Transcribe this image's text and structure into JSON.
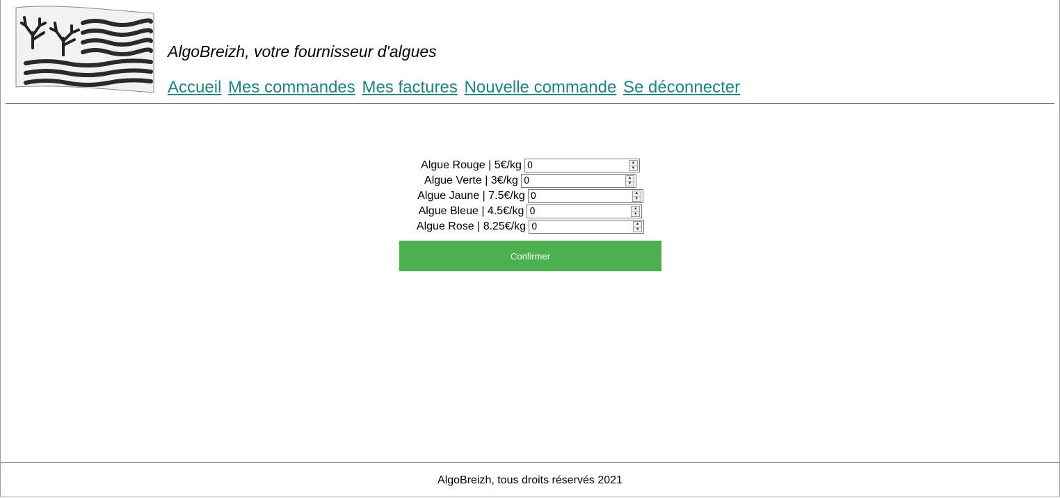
{
  "header": {
    "site_title": "AlgoBreizh, votre fournisseur d'algues",
    "nav": [
      {
        "label": "Accueil"
      },
      {
        "label": "Mes commandes"
      },
      {
        "label": "Mes factures"
      },
      {
        "label": "Nouvelle commande"
      },
      {
        "label": "Se déconnecter"
      }
    ],
    "logo_icon": "seaweed-flag-logo-icon"
  },
  "order_form": {
    "items": [
      {
        "label": "Algue Rouge | 5€/kg",
        "value": "0"
      },
      {
        "label": "Algue Verte | 3€/kg",
        "value": "0"
      },
      {
        "label": "Algue Jaune | 7.5€/kg",
        "value": "0"
      },
      {
        "label": "Algue Bleue | 4.5€/kg",
        "value": "0"
      },
      {
        "label": "Algue Rose | 8.25€/kg",
        "value": "0"
      }
    ],
    "confirm_label": "Confirmer",
    "confirm_color": "#4caf50"
  },
  "footer": {
    "text": "AlgoBreizh, tous droits réservés 2021"
  },
  "colors": {
    "link": "#168686"
  }
}
